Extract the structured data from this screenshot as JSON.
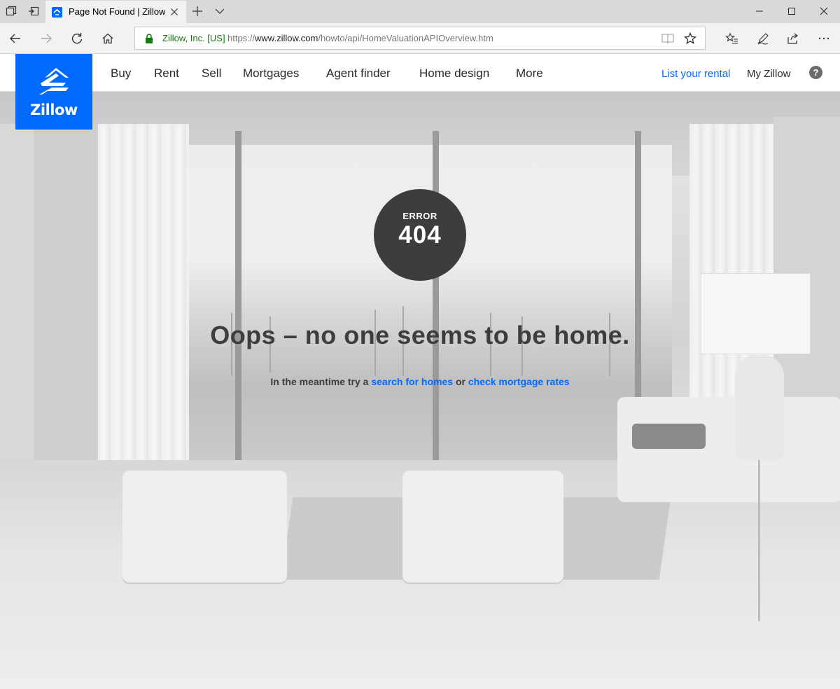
{
  "browser": {
    "tab_title": "Page Not Found | Zillow",
    "address_org": "Zillow, Inc. [US]",
    "url_scheme": "https://",
    "url_host": "www.zillow.com",
    "url_path": "/howto/api/HomeValuationAPIOverview.htm"
  },
  "header": {
    "logo_text": "Zillow",
    "nav": [
      "Buy",
      "Rent",
      "Sell",
      "Mortgages",
      "Agent finder",
      "Home design",
      "More"
    ],
    "list_rental": "List your rental",
    "my_zillow": "My Zillow",
    "help": "?"
  },
  "error": {
    "label": "ERROR",
    "code": "404",
    "headline": "Oops – no one seems to be home.",
    "sub_prefix": "In the meantime try a",
    "link1": "search for homes",
    "sub_mid": "or",
    "link2": "check mortgage rates"
  },
  "colors": {
    "brand": "#006aff",
    "error_circle": "#3d3d3d",
    "text": "#3d3d3d",
    "secure": "#107c10"
  }
}
